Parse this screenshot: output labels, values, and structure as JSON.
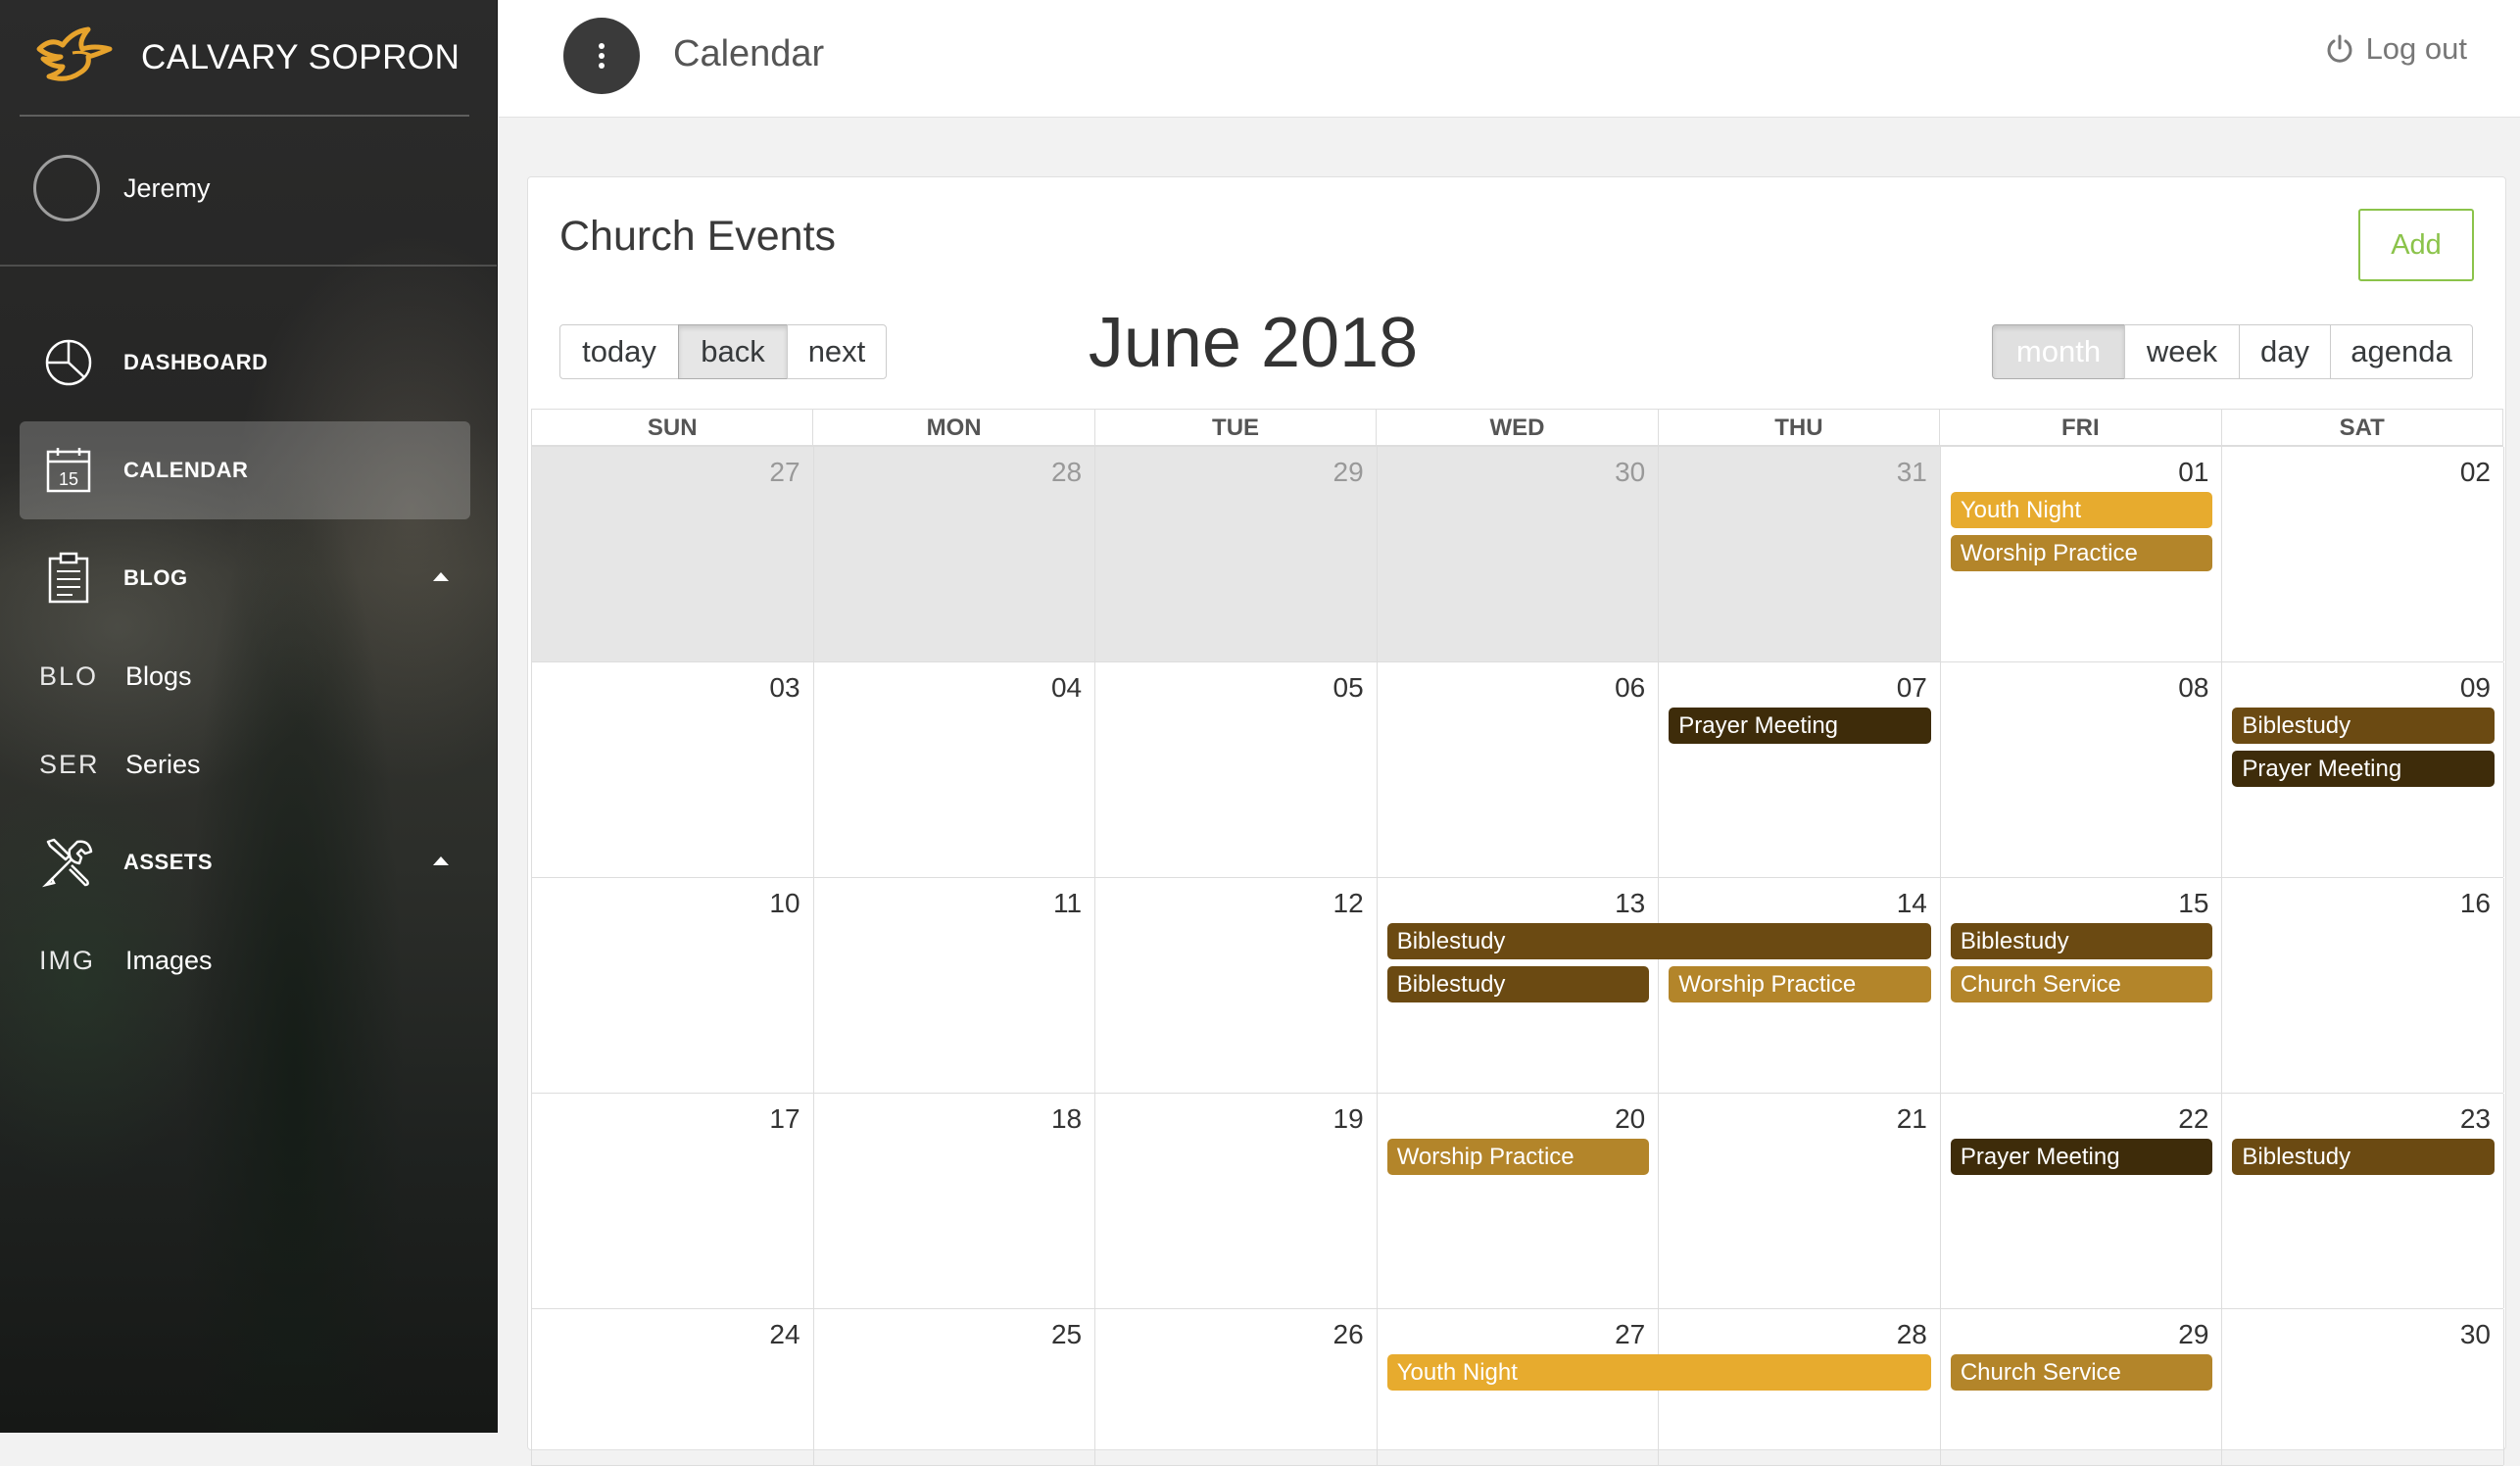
{
  "brand": {
    "title": "CALVARY SOPRON"
  },
  "user": {
    "name": "Jeremy"
  },
  "sidebar": {
    "items": [
      {
        "label": "DASHBOARD",
        "icon": "pie-chart-icon"
      },
      {
        "label": "CALENDAR",
        "icon": "calendar-icon",
        "icon_text": "15",
        "active": true
      },
      {
        "label": "BLOG",
        "icon": "clipboard-icon",
        "expanded": true
      },
      {
        "abbr": "BLO",
        "label": "Blogs"
      },
      {
        "abbr": "SER",
        "label": "Series"
      },
      {
        "label": "ASSETS",
        "icon": "tools-icon",
        "expanded": true
      },
      {
        "abbr": "IMG",
        "label": "Images"
      }
    ]
  },
  "topbar": {
    "title": "Calendar",
    "logout": "Log out"
  },
  "card": {
    "title": "Church Events",
    "add_label": "Add"
  },
  "toolbar": {
    "today": "today",
    "back": "back",
    "next": "next",
    "label": "June 2018",
    "views": [
      "month",
      "week",
      "day",
      "agenda"
    ],
    "active_view": "month"
  },
  "calendar": {
    "weekdays": [
      "SUN",
      "MON",
      "TUE",
      "WED",
      "THU",
      "FRI",
      "SAT"
    ],
    "weeks": [
      [
        "27",
        "28",
        "29",
        "30",
        "31",
        "01",
        "02"
      ],
      [
        "03",
        "04",
        "05",
        "06",
        "07",
        "08",
        "09"
      ],
      [
        "10",
        "11",
        "12",
        "13",
        "14",
        "15",
        "16"
      ],
      [
        "17",
        "18",
        "19",
        "20",
        "21",
        "22",
        "23"
      ],
      [
        "24",
        "25",
        "26",
        "27",
        "28",
        "29",
        "30"
      ]
    ],
    "events": [
      {
        "title": "Youth Night",
        "date": "2018-06-01",
        "color": "#e7ab2e"
      },
      {
        "title": "Worship Practice",
        "date": "2018-06-01",
        "color": "#b3852a"
      },
      {
        "title": "Prayer Meeting",
        "date": "2018-06-07",
        "color": "#3e2c0a"
      },
      {
        "title": "Biblestudy",
        "date": "2018-06-09",
        "color": "#6b4a12"
      },
      {
        "title": "Prayer Meeting",
        "date": "2018-06-09",
        "color": "#3e2c0a"
      },
      {
        "title": "Biblestudy",
        "date": "2018-06-13",
        "end": "2018-06-14",
        "color": "#6b4a12"
      },
      {
        "title": "Biblestudy",
        "date": "2018-06-13",
        "color": "#6b4a12"
      },
      {
        "title": "Worship Practice",
        "date": "2018-06-14",
        "color": "#b3852a"
      },
      {
        "title": "Biblestudy",
        "date": "2018-06-15",
        "color": "#6b4a12"
      },
      {
        "title": "Church Service",
        "date": "2018-06-15",
        "color": "#b3852a"
      },
      {
        "title": "Worship Practice",
        "date": "2018-06-20",
        "color": "#b3852a"
      },
      {
        "title": "Prayer Meeting",
        "date": "2018-06-22",
        "color": "#3e2c0a"
      },
      {
        "title": "Biblestudy",
        "date": "2018-06-23",
        "color": "#6b4a12"
      },
      {
        "title": "Youth Night",
        "date": "2018-06-27",
        "end": "2018-06-28",
        "color": "#e7ab2e"
      },
      {
        "title": "Church Service",
        "date": "2018-06-29",
        "color": "#b3852a"
      }
    ]
  }
}
